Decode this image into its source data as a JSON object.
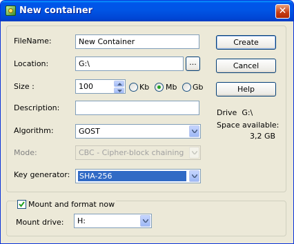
{
  "window": {
    "title": "New container",
    "close_label": "✕"
  },
  "form": {
    "filename_label": "FileName:",
    "filename_value": "New Container",
    "location_label": "Location:",
    "location_value": "G:\\",
    "browse_label": "...",
    "size_label": "Size :",
    "size_value": "100",
    "size_units": [
      {
        "label": "Kb",
        "checked": false
      },
      {
        "label": "Mb",
        "checked": true
      },
      {
        "label": "Gb",
        "checked": false
      }
    ],
    "description_label": "Description:",
    "description_value": "",
    "algorithm_label": "Algorithm:",
    "algorithm_value": "GOST",
    "mode_label": "Mode:",
    "mode_value": "CBC - Cipher-block chaining",
    "keygen_label": "Key generator:",
    "keygen_value": "SHA-256"
  },
  "buttons": {
    "create": "Create",
    "cancel": "Cancel",
    "help": "Help"
  },
  "drive_info": {
    "drive_label": "Drive  G:\\",
    "space_label": "Space available:",
    "space_value": "3,2 GB"
  },
  "mount": {
    "checkbox_label": "Mount and format now",
    "checked": true,
    "drive_label": "Mount drive:",
    "drive_value": "H:"
  }
}
